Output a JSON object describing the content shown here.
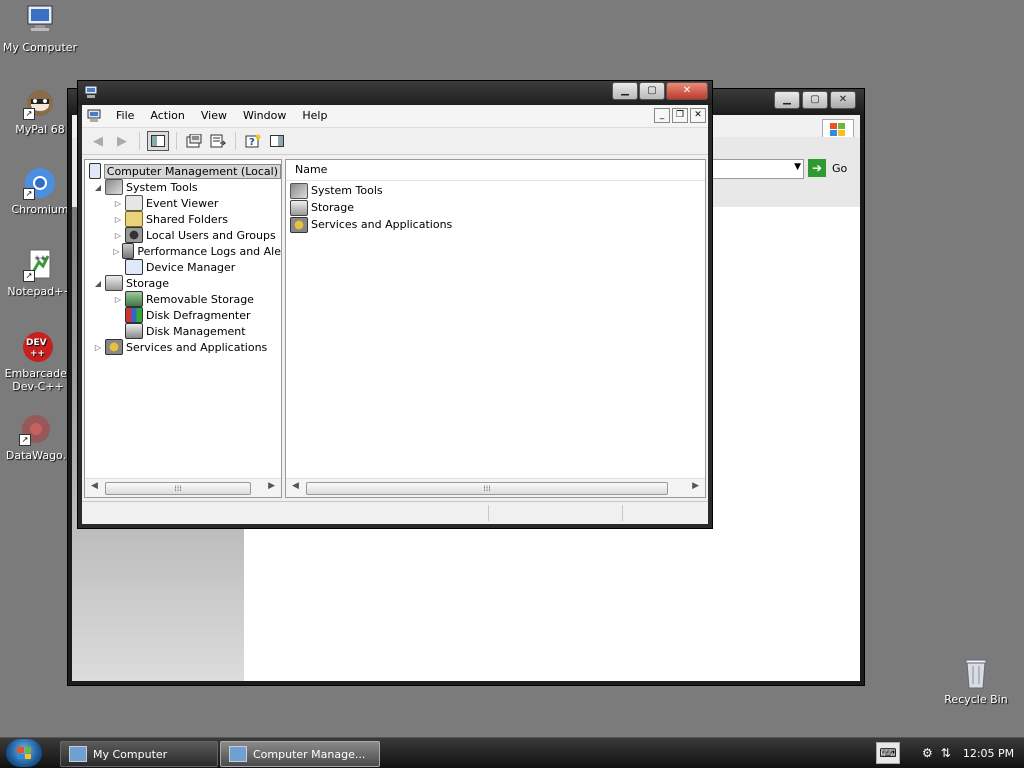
{
  "desktop": {
    "icons": [
      {
        "label": "My Computer",
        "icon": "computer-icon"
      },
      {
        "label": "MyPal 68",
        "icon": "mypal-icon"
      },
      {
        "label": "Chromium",
        "icon": "chromium-icon"
      },
      {
        "label": "Notepad++",
        "icon": "notepadpp-icon"
      },
      {
        "label": "Embarcadero Dev-C++",
        "label_line1": "Embarcader",
        "label_line2": "Dev-C++",
        "icon": "devcpp-icon"
      },
      {
        "label": "DataWago...",
        "label_display": "DataWago.",
        "icon": "datawago-icon"
      },
      {
        "label": "Recycle Bin",
        "icon": "recycle-bin-icon"
      }
    ]
  },
  "background_window": {
    "address_go_label": "Go",
    "caption_min": "▁",
    "caption_max": "▢",
    "caption_close": "✕"
  },
  "main_window": {
    "caption_min": "▁",
    "caption_max": "▢",
    "caption_close": "✕",
    "menu": [
      "File",
      "Action",
      "View",
      "Window",
      "Help"
    ],
    "mdi": {
      "min": "_",
      "restore": "❐",
      "close": "✕"
    },
    "toolbar": [
      "back",
      "forward",
      "show-hide-console-tree",
      "properties",
      "export-list",
      "help",
      "show-hide-action-pane"
    ],
    "tree": {
      "root": "Computer Management (Local)",
      "system_tools": "System Tools",
      "event_viewer": "Event Viewer",
      "shared_folders": "Shared Folders",
      "local_users": "Local Users and Groups",
      "perf_logs": "Performance Logs and Ale",
      "device_manager": "Device Manager",
      "storage": "Storage",
      "removable_storage": "Removable Storage",
      "disk_defrag": "Disk Defragmenter",
      "disk_mgmt": "Disk Management",
      "services_apps": "Services and Applications"
    },
    "list": {
      "column_name": "Name",
      "items": [
        "System Tools",
        "Storage",
        "Services and Applications"
      ]
    },
    "scroll_thumb_grip": "⁞⁞⁞"
  },
  "taskbar": {
    "tasks": [
      "My Computer",
      "Computer Manage..."
    ],
    "clock": "12:05 PM"
  },
  "colors": {
    "desktop": "#7b7b7b",
    "close_button": "#c0392b",
    "go_arrow": "#2f9a2f"
  }
}
